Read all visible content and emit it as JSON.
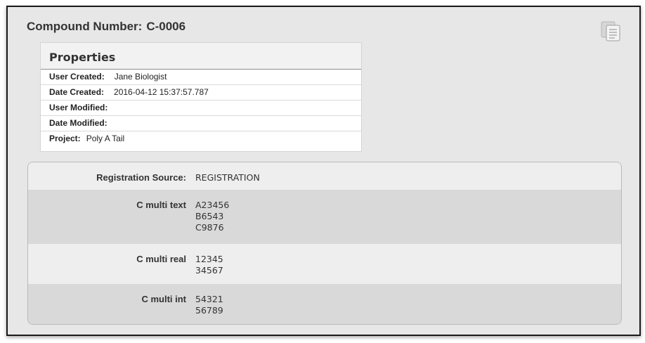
{
  "header": {
    "label": "Compound Number:",
    "number": "C-0006",
    "copy_icon": "copy-icon"
  },
  "properties": {
    "heading": "Properties",
    "rows": [
      {
        "label": "User Created:",
        "value": "Jane Biologist"
      },
      {
        "label": "Date Created:",
        "value": "2016-04-12 15:37:57.787"
      },
      {
        "label": "User Modified:",
        "value": ""
      },
      {
        "label": "Date Modified:",
        "value": ""
      },
      {
        "label": "Project:",
        "value": "Poly A Tail"
      }
    ]
  },
  "details": {
    "rows": [
      {
        "label": "Registration Source:",
        "values": [
          "REGISTRATION"
        ]
      },
      {
        "label": "C multi text",
        "values": [
          "A23456",
          "B6543",
          "C9876"
        ]
      },
      {
        "label": "C multi real",
        "values": [
          "12345",
          "34567"
        ]
      },
      {
        "label": "C multi int",
        "values": [
          "54321",
          "56789"
        ]
      }
    ]
  }
}
